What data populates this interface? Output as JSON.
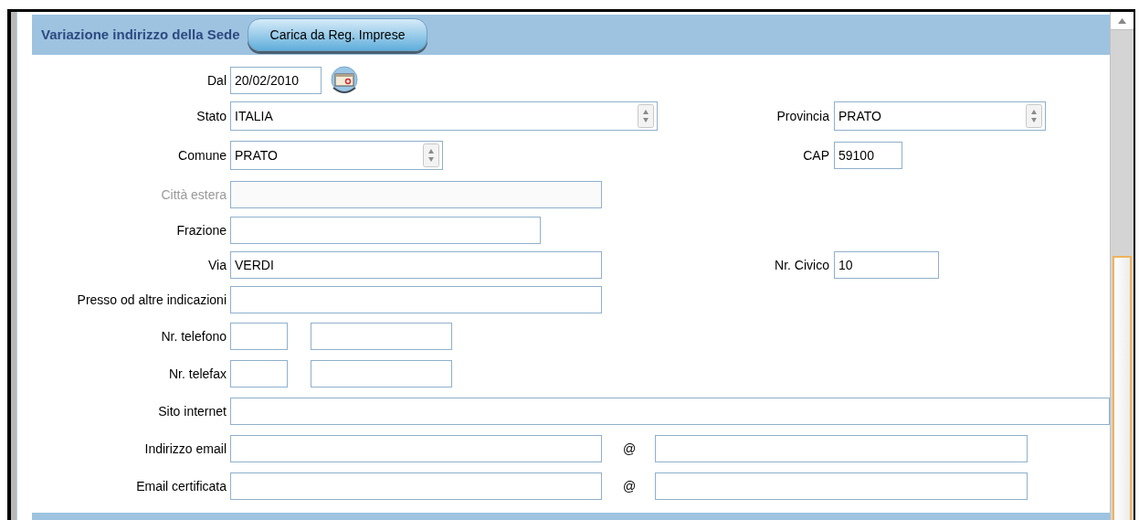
{
  "panel": {
    "title": "Variazione indirizzo della Sede",
    "load_button": "Carica da Reg. Imprese"
  },
  "rows": [
    {
      "label": "Dal",
      "disabled": false,
      "fields": [
        {
          "kind": "date",
          "value": "20/02/2010"
        }
      ]
    },
    {
      "label": "Stato",
      "disabled": false,
      "fields": [
        {
          "kind": "select",
          "value": "ITALIA"
        }
      ],
      "right": {
        "label": "Provincia",
        "field": {
          "kind": "select",
          "value": "PRATO"
        }
      }
    },
    {
      "label": "Comune",
      "disabled": false,
      "fields": [
        {
          "kind": "select",
          "value": "PRATO"
        }
      ],
      "right": {
        "label": "CAP",
        "field": {
          "kind": "text",
          "value": "59100"
        }
      }
    },
    {
      "label": "Città estera",
      "disabled": true,
      "fields": [
        {
          "kind": "text"
        }
      ]
    },
    {
      "label": "Frazione",
      "disabled": false,
      "fields": [
        {
          "kind": "text"
        }
      ]
    },
    {
      "label": "Via",
      "disabled": false,
      "fields": [
        {
          "kind": "text",
          "value": "VERDI"
        }
      ],
      "right": {
        "label": "Nr. Civico",
        "field": {
          "kind": "text",
          "value": "10"
        }
      }
    },
    {
      "label": "Presso od altre indicazioni",
      "disabled": false,
      "fields": [
        {
          "kind": "text"
        }
      ]
    },
    {
      "label": "Nr. telefono",
      "disabled": false,
      "fields": [
        {
          "kind": "text"
        },
        {
          "kind": "text"
        }
      ]
    },
    {
      "label": "Nr. telefax",
      "disabled": false,
      "fields": [
        {
          "kind": "text"
        },
        {
          "kind": "text"
        }
      ]
    },
    {
      "label": "Sito internet",
      "disabled": false,
      "fields": [
        {
          "kind": "text"
        }
      ]
    },
    {
      "label": "Indirizzo email",
      "disabled": false,
      "fields": [
        {
          "kind": "text"
        },
        {
          "kind": "separator",
          "text": "@"
        },
        {
          "kind": "text"
        }
      ]
    },
    {
      "label": "Email certificata",
      "disabled": false,
      "fields": [
        {
          "kind": "text"
        },
        {
          "kind": "separator",
          "text": "@"
        },
        {
          "kind": "text"
        }
      ]
    }
  ]
}
